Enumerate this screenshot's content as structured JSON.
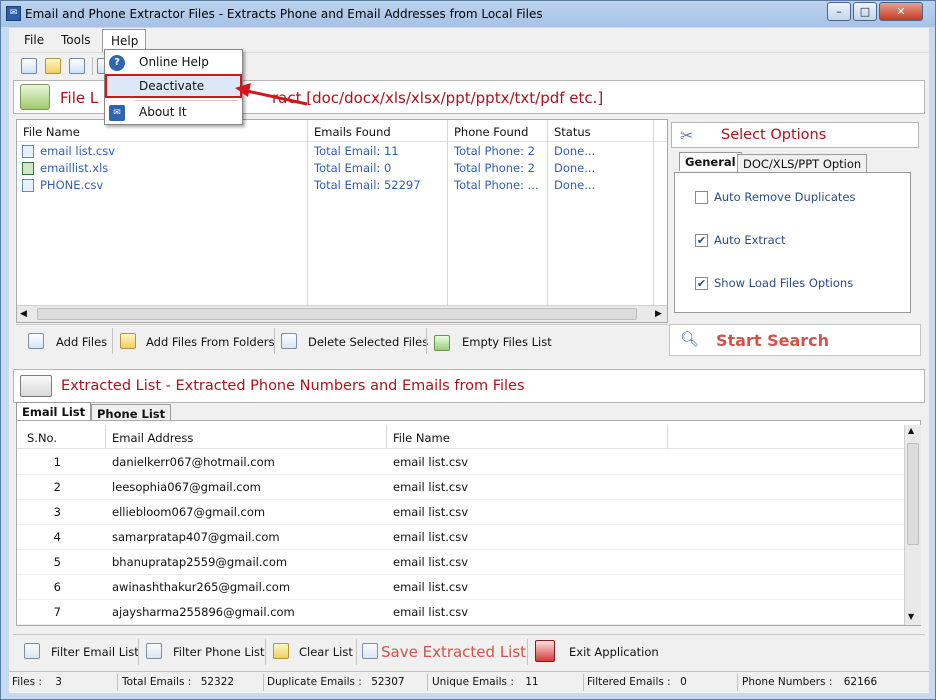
{
  "window": {
    "title": "Email and Phone Extractor Files  -  Extracts Phone and Email Addresses from Local Files",
    "minimize": "–",
    "maximize": "□",
    "close": "✕"
  },
  "menubar": {
    "file": "File",
    "tools": "Tools",
    "help": "Help"
  },
  "help_menu": {
    "items": [
      {
        "label": "Online Help",
        "icon": "help-icon"
      },
      {
        "label": "Deactivate",
        "icon": ""
      },
      {
        "label": "About It",
        "icon": "about-icon"
      }
    ]
  },
  "file_list": {
    "title_visible": "File L",
    "title_suffix": "ract  [doc/docx/xls/xlsx/ppt/pptx/txt/pdf etc.]",
    "columns": [
      "File Name",
      "Emails Found",
      "Phone Found",
      "Status"
    ],
    "rows": [
      {
        "name": "email list.csv",
        "emails": "Total Email: 11",
        "phones": "Total Phone: 2",
        "status": "Done..."
      },
      {
        "name": "emaillist.xls",
        "emails": "Total Email: 0",
        "phones": "Total Phone: 2",
        "status": "Done..."
      },
      {
        "name": "PHONE.csv",
        "emails": "Total Email: 52297",
        "phones": "Total Phone: ...",
        "status": "Done..."
      }
    ]
  },
  "file_buttons": {
    "add_files": "Add Files",
    "add_folders": "Add Files From Folders",
    "delete_selected": "Delete Selected Files",
    "empty_list": "Empty Files List"
  },
  "options": {
    "title": "Select Options",
    "tabs": [
      "General",
      "DOC/XLS/PPT Option"
    ],
    "checks": [
      {
        "label": "Auto Remove Duplicates",
        "checked": false
      },
      {
        "label": "Auto Extract",
        "checked": true
      },
      {
        "label": "Show Load Files Options",
        "checked": true
      }
    ],
    "start_search": "Start Search"
  },
  "extracted": {
    "title": "Extracted List - Extracted Phone Numbers and Emails from Files",
    "tabs": [
      "Email List",
      "Phone List"
    ],
    "columns": [
      "S.No.",
      "Email Address",
      "File Name"
    ],
    "rows": [
      {
        "sno": "1",
        "email": "danielkerr067@hotmail.com",
        "file": "email list.csv"
      },
      {
        "sno": "2",
        "email": "leesophia067@gmail.com",
        "file": "email list.csv"
      },
      {
        "sno": "3",
        "email": "elliebloom067@gmail.com",
        "file": "email list.csv"
      },
      {
        "sno": "4",
        "email": "samarpratap407@gmail.com",
        "file": "email list.csv"
      },
      {
        "sno": "5",
        "email": "bhanupratap2559@gmail.com",
        "file": "email list.csv"
      },
      {
        "sno": "6",
        "email": "awinashthakur265@gmail.com",
        "file": "email list.csv"
      },
      {
        "sno": "7",
        "email": "ajaysharma255896@gmail.com",
        "file": "email list.csv"
      }
    ]
  },
  "bottom_buttons": {
    "filter_email": "Filter Email List",
    "filter_phone": "Filter Phone List",
    "clear_list": "Clear List",
    "save_extracted": "Save Extracted List",
    "exit": "Exit Application"
  },
  "status": {
    "files_label": "Files :",
    "files": "3",
    "total_emails_label": "Total Emails :",
    "total_emails": "52322",
    "duplicate_label": "Duplicate Emails :",
    "duplicate": "52307",
    "unique_label": "Unique Emails :",
    "unique": "11",
    "filtered_label": "Filtered Emails :",
    "filtered": "0",
    "phone_label": "Phone Numbers :",
    "phone": "62166"
  },
  "colors": {
    "accent_red": "#b0111b",
    "link_blue": "#2f5fb5",
    "highlight_border": "#d4151b"
  }
}
